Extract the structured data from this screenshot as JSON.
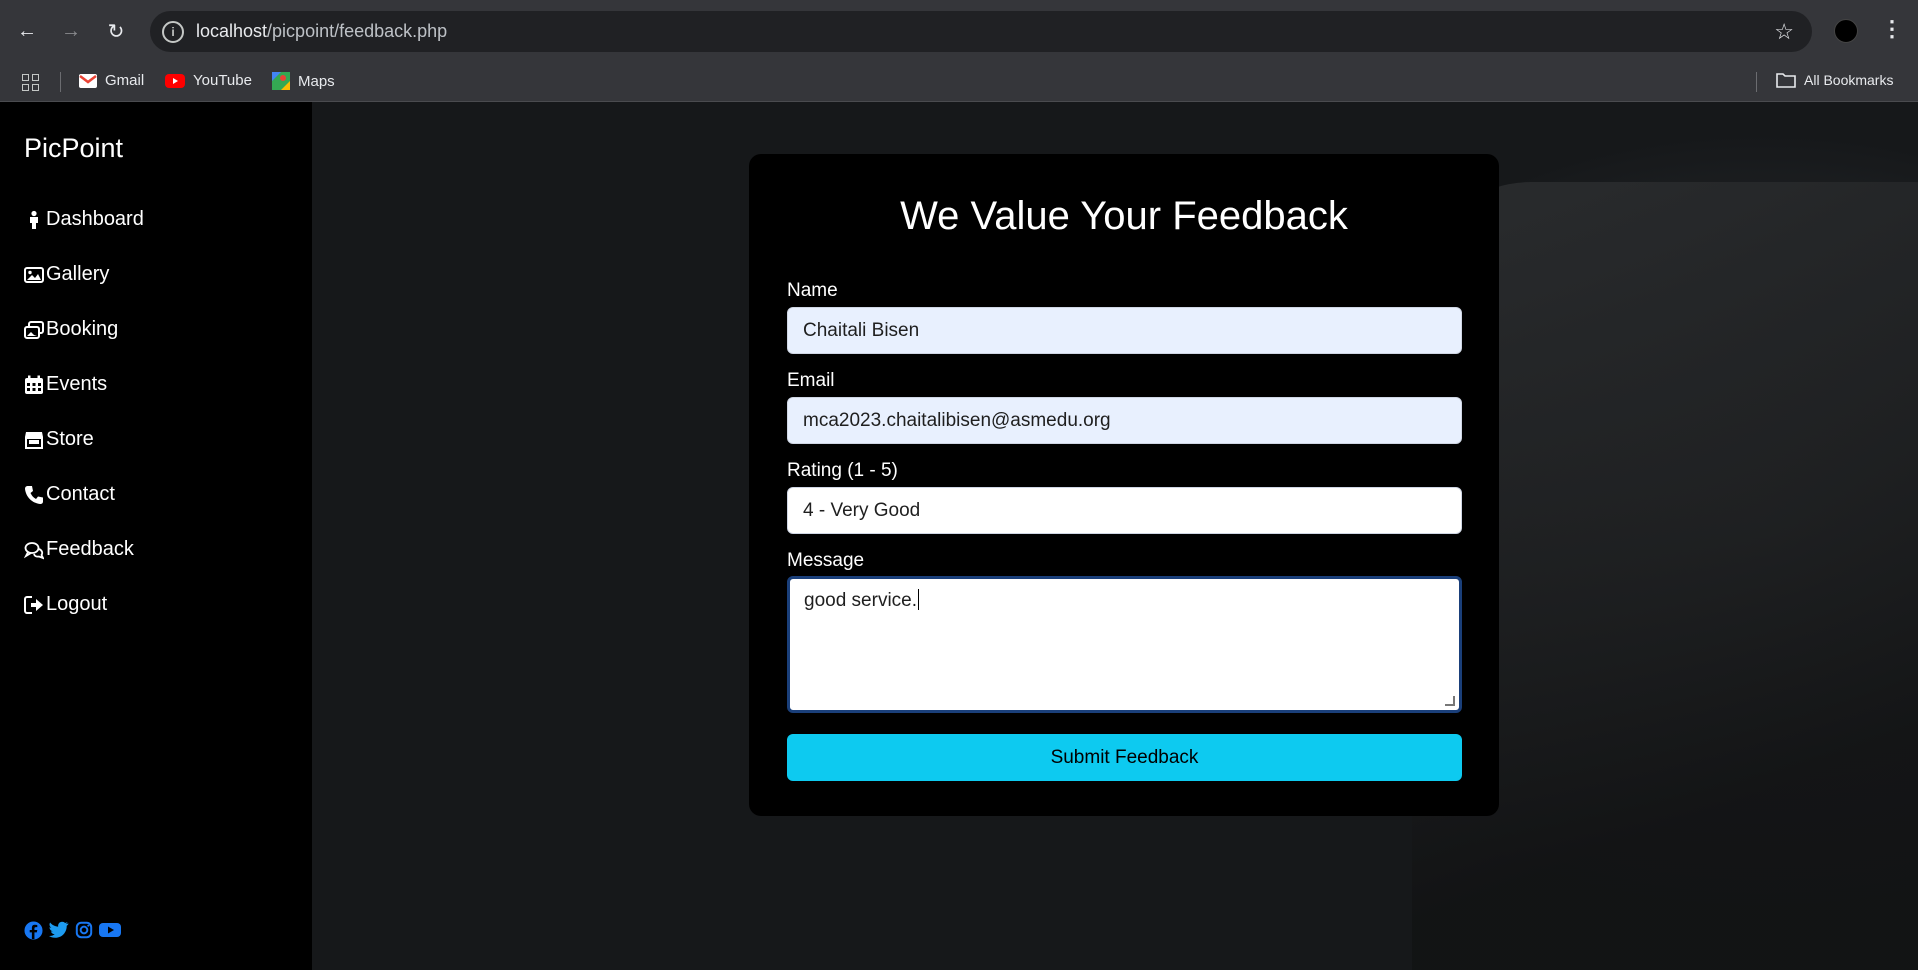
{
  "browser": {
    "url_host": "localhost",
    "url_path": "/picpoint/feedback.php",
    "bookmarks": [
      {
        "label": "Gmail",
        "icon": "gmail-icon"
      },
      {
        "label": "YouTube",
        "icon": "youtube-icon"
      },
      {
        "label": "Maps",
        "icon": "maps-icon"
      }
    ],
    "all_bookmarks": "All Bookmarks"
  },
  "sidebar": {
    "brand": "PicPoint",
    "items": [
      {
        "label": "Dashboard",
        "icon": "person-icon"
      },
      {
        "label": "Gallery",
        "icon": "image-icon"
      },
      {
        "label": "Booking",
        "icon": "images-icon"
      },
      {
        "label": "Events",
        "icon": "calendar-icon"
      },
      {
        "label": "Store",
        "icon": "store-icon"
      },
      {
        "label": "Contact",
        "icon": "phone-icon"
      },
      {
        "label": "Feedback",
        "icon": "chat-icon"
      },
      {
        "label": "Logout",
        "icon": "logout-icon"
      }
    ],
    "social": [
      "facebook-icon",
      "twitter-icon",
      "instagram-icon",
      "youtube-icon"
    ]
  },
  "form": {
    "title": "We Value Your Feedback",
    "name_label": "Name",
    "name_value": "Chaitali Bisen",
    "email_label": "Email",
    "email_value": "mca2023.chaitalibisen@asmedu.org",
    "rating_label": "Rating (1 - 5)",
    "rating_value": "4 - Very Good",
    "message_label": "Message",
    "message_value": "good service.",
    "submit_label": "Submit Feedback"
  },
  "colors": {
    "accent": "#0dcaf0",
    "sidebar_bg": "#000000",
    "social_blue": "#1877f2"
  }
}
